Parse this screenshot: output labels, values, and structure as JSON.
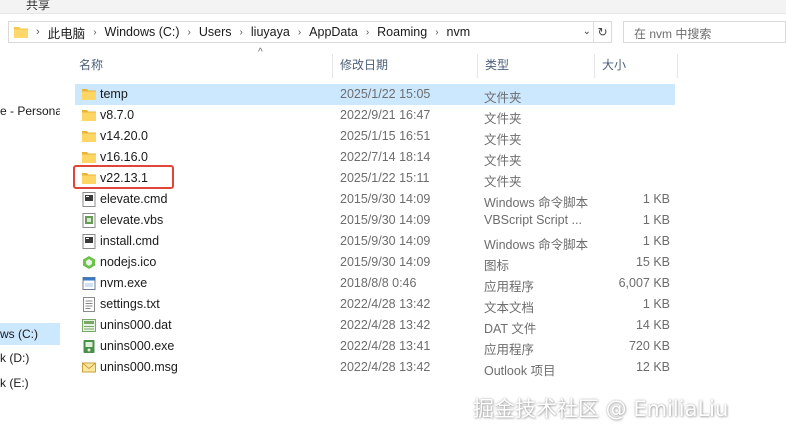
{
  "ribbon": {
    "share_label": "共享"
  },
  "address": {
    "crumbs": [
      "此电脑",
      "Windows (C:)",
      "Users",
      "liuyaya",
      "AppData",
      "Roaming",
      "nvm"
    ],
    "search_placeholder": "在 nvm 中搜索"
  },
  "nav": {
    "item_personal": "e - Persona",
    "drive_c": "ws (C:)",
    "drive_d": "k (D:)",
    "drive_e": "k (E:)"
  },
  "columns": {
    "name": "名称",
    "date": "修改日期",
    "type": "类型",
    "size": "大小"
  },
  "files": [
    {
      "name": "temp",
      "date": "2025/1/22 15:05",
      "type": "文件夹",
      "size": "",
      "icon": "folder-icon"
    },
    {
      "name": "v8.7.0",
      "date": "2022/9/21 16:47",
      "type": "文件夹",
      "size": "",
      "icon": "folder-icon"
    },
    {
      "name": "v14.20.0",
      "date": "2025/1/15 16:51",
      "type": "文件夹",
      "size": "",
      "icon": "folder-icon"
    },
    {
      "name": "v16.16.0",
      "date": "2022/7/14 18:14",
      "type": "文件夹",
      "size": "",
      "icon": "folder-icon"
    },
    {
      "name": "v22.13.1",
      "date": "2025/1/22 15:11",
      "type": "文件夹",
      "size": "",
      "icon": "folder-icon"
    },
    {
      "name": "elevate.cmd",
      "date": "2015/9/30 14:09",
      "type": "Windows 命令脚本",
      "size": "1 KB",
      "icon": "cmd-file-icon"
    },
    {
      "name": "elevate.vbs",
      "date": "2015/9/30 14:09",
      "type": "VBScript Script ...",
      "size": "1 KB",
      "icon": "vbs-file-icon"
    },
    {
      "name": "install.cmd",
      "date": "2015/9/30 14:09",
      "type": "Windows 命令脚本",
      "size": "1 KB",
      "icon": "cmd-file-icon"
    },
    {
      "name": "nodejs.ico",
      "date": "2015/9/30 14:09",
      "type": "图标",
      "size": "15 KB",
      "icon": "nodejs-icon"
    },
    {
      "name": "nvm.exe",
      "date": "2018/8/8 0:46",
      "type": "应用程序",
      "size": "6,007 KB",
      "icon": "exe-file-icon"
    },
    {
      "name": "settings.txt",
      "date": "2022/4/28 13:42",
      "type": "文本文档",
      "size": "1 KB",
      "icon": "text-file-icon"
    },
    {
      "name": "unins000.dat",
      "date": "2022/4/28 13:42",
      "type": "DAT 文件",
      "size": "14 KB",
      "icon": "dat-file-icon"
    },
    {
      "name": "unins000.exe",
      "date": "2022/4/28 13:41",
      "type": "应用程序",
      "size": "720 KB",
      "icon": "installer-icon"
    },
    {
      "name": "unins000.msg",
      "date": "2022/4/28 13:42",
      "type": "Outlook 项目",
      "size": "12 KB",
      "icon": "mail-file-icon"
    }
  ],
  "watermark": "掘金技术社区 @ EmiliaLiu",
  "colors": {
    "selection": "#cce8ff",
    "highlight_box": "#e0453a",
    "folder": "#f4c64a"
  }
}
